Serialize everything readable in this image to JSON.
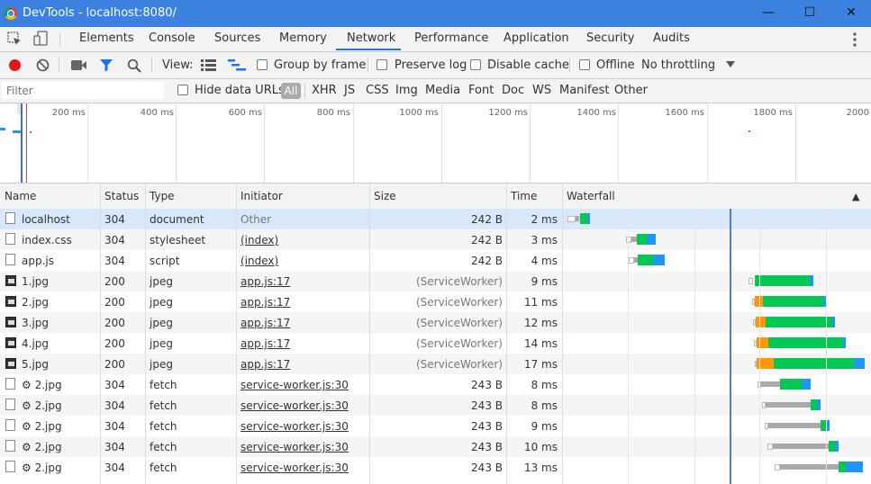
{
  "window": {
    "title": "DevTools - localhost:8080/",
    "minimize": "—",
    "maximize": "☐",
    "close": "✕"
  },
  "tabs": [
    "Elements",
    "Console",
    "Sources",
    "Memory",
    "Network",
    "Performance",
    "Application",
    "Security",
    "Audits"
  ],
  "active_tab": "Network",
  "toolbar": {
    "view_label": "View:",
    "group_by_frame": "Group by frame",
    "preserve_log": "Preserve log",
    "disable_cache": "Disable cache",
    "offline": "Offline",
    "throttling": "No throttling"
  },
  "filterbar": {
    "placeholder": "Filter",
    "hide_data_urls": "Hide data URLs",
    "types": [
      "All",
      "XHR",
      "JS",
      "CSS",
      "Img",
      "Media",
      "Font",
      "Doc",
      "WS",
      "Manifest",
      "Other"
    ]
  },
  "overview": {
    "ticks": [
      "200 ms",
      "400 ms",
      "600 ms",
      "800 ms",
      "1000 ms",
      "1200 ms",
      "1400 ms",
      "1600 ms",
      "1800 ms",
      "2000"
    ]
  },
  "columns": {
    "name": "Name",
    "status": "Status",
    "type": "Type",
    "initiator": "Initiator",
    "size": "Size",
    "time": "Time",
    "waterfall": "Waterfall",
    "sort_icon": "▲"
  },
  "rows": [
    {
      "name": "localhost",
      "status": "304",
      "type": "document",
      "initiator": "Other",
      "size": "242 B",
      "time": "2 ms",
      "icon": "file-icon"
    },
    {
      "name": "index.css",
      "status": "304",
      "type": "stylesheet",
      "initiator": "(index)",
      "size": "242 B",
      "time": "3 ms",
      "icon": "file-icon"
    },
    {
      "name": "app.js",
      "status": "304",
      "type": "script",
      "initiator": "(index)",
      "size": "242 B",
      "time": "4 ms",
      "icon": "file-icon"
    },
    {
      "name": "1.jpg",
      "status": "200",
      "type": "jpeg",
      "initiator": "app.js:17",
      "size": "(ServiceWorker)",
      "time": "9 ms",
      "icon": "image-icon"
    },
    {
      "name": "2.jpg",
      "status": "200",
      "type": "jpeg",
      "initiator": "app.js:17",
      "size": "(ServiceWorker)",
      "time": "11 ms",
      "icon": "image-icon"
    },
    {
      "name": "3.jpg",
      "status": "200",
      "type": "jpeg",
      "initiator": "app.js:17",
      "size": "(ServiceWorker)",
      "time": "12 ms",
      "icon": "image-icon"
    },
    {
      "name": "4.jpg",
      "status": "200",
      "type": "jpeg",
      "initiator": "app.js:17",
      "size": "(ServiceWorker)",
      "time": "14 ms",
      "icon": "image-icon"
    },
    {
      "name": "5.jpg",
      "status": "200",
      "type": "jpeg",
      "initiator": "app.js:17",
      "size": "(ServiceWorker)",
      "time": "17 ms",
      "icon": "image-icon"
    },
    {
      "name": "⚙ 2.jpg",
      "status": "304",
      "type": "fetch",
      "initiator": "service-worker.js:30",
      "size": "243 B",
      "time": "8 ms",
      "icon": "file-icon"
    },
    {
      "name": "⚙ 2.jpg",
      "status": "304",
      "type": "fetch",
      "initiator": "service-worker.js:30",
      "size": "243 B",
      "time": "8 ms",
      "icon": "file-icon"
    },
    {
      "name": "⚙ 2.jpg",
      "status": "304",
      "type": "fetch",
      "initiator": "service-worker.js:30",
      "size": "243 B",
      "time": "9 ms",
      "icon": "file-icon"
    },
    {
      "name": "⚙ 2.jpg",
      "status": "304",
      "type": "fetch",
      "initiator": "service-worker.js:30",
      "size": "243 B",
      "time": "10 ms",
      "icon": "file-icon"
    },
    {
      "name": "⚙ 2.jpg",
      "status": "304",
      "type": "fetch",
      "initiator": "service-worker.js:30",
      "size": "243 B",
      "time": "13 ms",
      "icon": "file-icon"
    }
  ],
  "colors": {
    "accent": "#1a73e8",
    "record": "#e0161b",
    "waiting": "#00c853",
    "download": "#2196f3",
    "stalled": "#ff9800",
    "queued": "#aaaaaa"
  }
}
